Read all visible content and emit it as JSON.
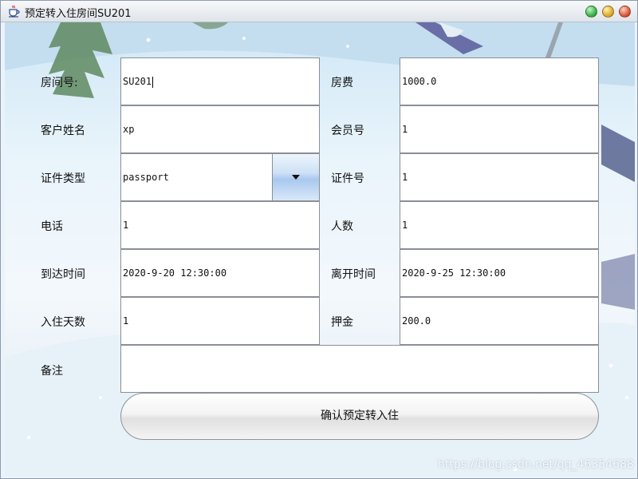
{
  "window": {
    "title": "预定转入住房间SU201",
    "buttons": [
      "minimize",
      "maximize",
      "close"
    ]
  },
  "form": {
    "room_no": {
      "label": "房间号:",
      "value": "SU201"
    },
    "room_fee": {
      "label": "房费",
      "value": "1000.0"
    },
    "customer_name": {
      "label": "客户姓名",
      "value": "xp"
    },
    "member_no": {
      "label": "会员号",
      "value": "1"
    },
    "id_type": {
      "label": "证件类型",
      "value": "passport"
    },
    "id_no": {
      "label": "证件号",
      "value": "1"
    },
    "phone": {
      "label": "电话",
      "value": "1"
    },
    "people_count": {
      "label": "人数",
      "value": "1"
    },
    "arrival_time": {
      "label": "到达时间",
      "value": "2020-9-20 12:30:00"
    },
    "departure_time": {
      "label": "离开时间",
      "value": "2020-9-25 12:30:00"
    },
    "stay_days": {
      "label": "入住天数",
      "value": "1"
    },
    "deposit": {
      "label": "押金",
      "value": "200.0"
    },
    "remarks": {
      "label": "备注",
      "value": ""
    }
  },
  "confirm_button": {
    "label": "确认预定转入住"
  },
  "watermark": "https://blog.csdn.net/qq_46354688",
  "colors": {
    "title_bar": "#e9edf2",
    "combo_button": "#a9c8ee",
    "background": "#dfeef8"
  }
}
